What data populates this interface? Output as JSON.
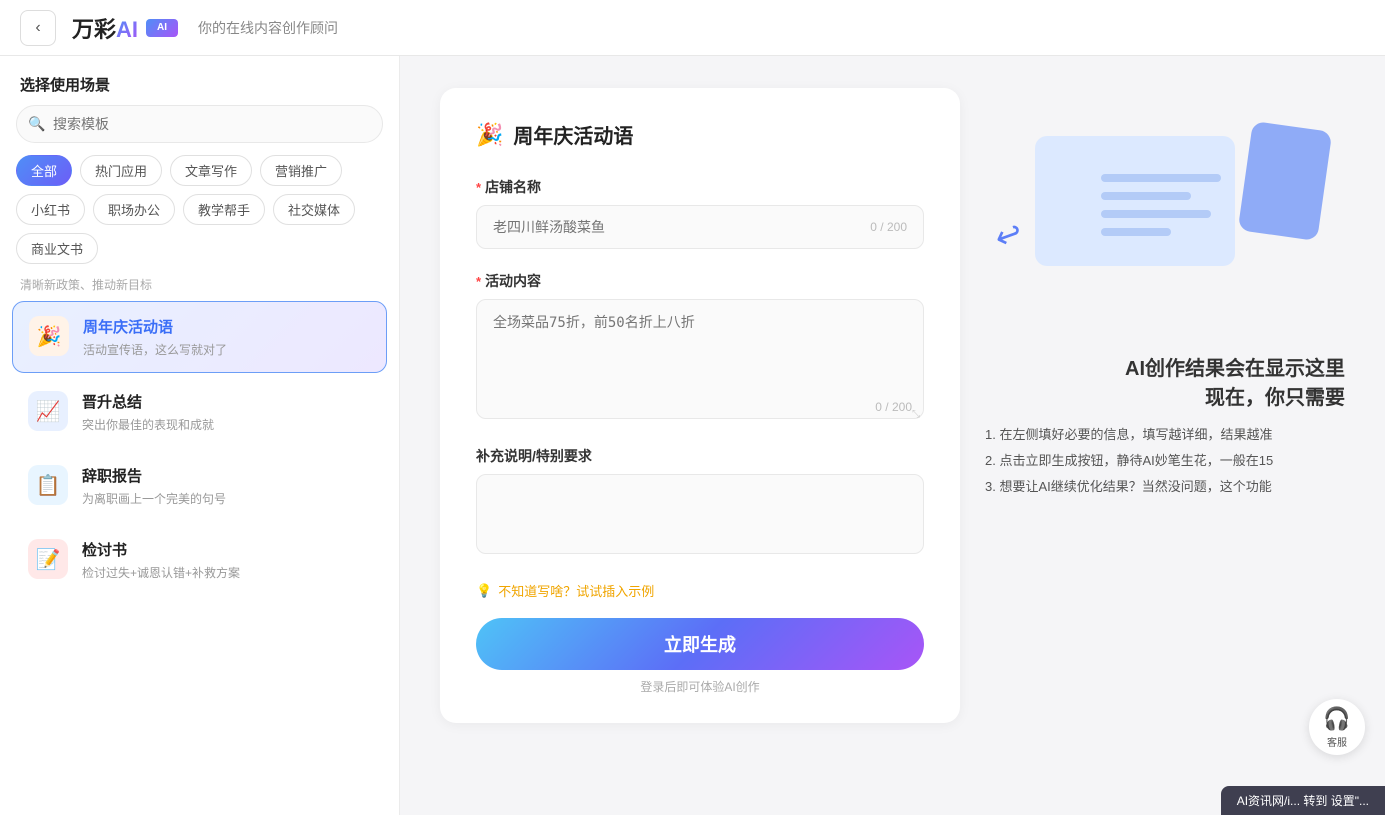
{
  "header": {
    "back_label": "‹",
    "logo_text": "万彩",
    "logo_ai": "AI",
    "subtitle": "你的在线内容创作顾问"
  },
  "sidebar": {
    "title": "选择使用场景",
    "search_placeholder": "搜索模板",
    "tags": [
      {
        "label": "全部",
        "active": true
      },
      {
        "label": "热门应用",
        "active": false
      },
      {
        "label": "文章写作",
        "active": false
      },
      {
        "label": "营销推广",
        "active": false
      },
      {
        "label": "小红书",
        "active": false
      },
      {
        "label": "职场办公",
        "active": false
      },
      {
        "label": "教学帮手",
        "active": false
      },
      {
        "label": "社交媒体",
        "active": false
      },
      {
        "label": "商业文书",
        "active": false
      }
    ],
    "section_hint": "清晰新政策、推动新目标",
    "items": [
      {
        "id": "anniversary",
        "icon": "🎉",
        "icon_class": "icon-party",
        "title": "周年庆活动语",
        "desc": "活动宣传语，这么写就对了",
        "active": true
      },
      {
        "id": "promotion",
        "icon": "📈",
        "icon_class": "icon-up",
        "title": "晋升总结",
        "desc": "突出你最佳的表现和成就",
        "active": false
      },
      {
        "id": "resign",
        "icon": "📋",
        "icon_class": "icon-resign",
        "title": "辞职报告",
        "desc": "为离职画上一个完美的句号",
        "active": false
      },
      {
        "id": "review",
        "icon": "📝",
        "icon_class": "icon-review",
        "title": "检讨书",
        "desc": "检讨过失+诚恩认错+补救方案",
        "active": false
      }
    ]
  },
  "form": {
    "title": "周年庆活动语",
    "title_icon": "🎉",
    "fields": {
      "shop_name": {
        "label": "店铺名称",
        "required": true,
        "placeholder": "老四川鲜汤酸菜鱼",
        "count": "0 / 200"
      },
      "activity_content": {
        "label": "活动内容",
        "required": true,
        "placeholder": "全场菜品75折，前50名折上八折",
        "count": "0 / 200"
      },
      "supplement": {
        "label": "补充说明/特别要求",
        "required": false,
        "placeholder": ""
      }
    },
    "example_hint": "不知道写啥？试试插入示例",
    "generate_btn": "立即生成",
    "login_hint": "登录后即可体验AI创作"
  },
  "right_panel": {
    "ai_title_line1": "AI创作结果会在显示这里",
    "ai_title_line2": "现在，你只需要",
    "tips": [
      "1. 在左侧填好必要的信息，填写越详细，结果越准",
      "2. 点击立即生成按钮，静待AI妙笔生花，一般在15",
      "3. 想要让AI继续优化结果？当然没问题，这个功能"
    ]
  },
  "customer_service": {
    "label": "客服"
  },
  "bottom_banner": {
    "label": "AI资讯网/i... 转到 设置\"..."
  }
}
